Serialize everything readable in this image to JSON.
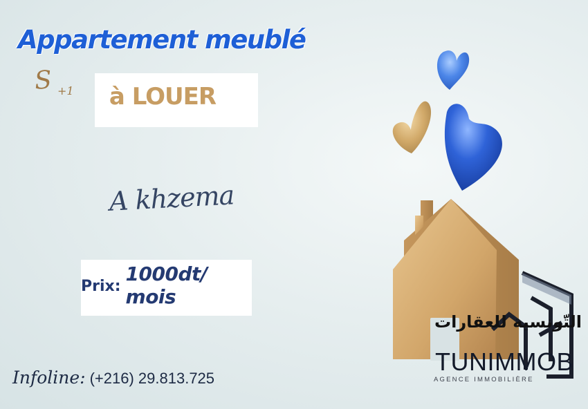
{
  "listing": {
    "title": "Appartement meublé",
    "type_main": "S",
    "type_sup": "+1",
    "status": "à LOUER",
    "location": "A khzema",
    "price_label": "Prix:",
    "price_value": "1000dt/ mois"
  },
  "contact": {
    "label": "Infoline:",
    "phone": "(+216) 29.813.725"
  },
  "brand": {
    "arabic_name": "التّونسية للعقارات",
    "name": "TUNIMMOB",
    "tagline": "AGENCE IMMOBILIÈRE"
  },
  "colors": {
    "title_blue": "#1e5fd6",
    "gold": "#c79d63",
    "navy": "#243a72",
    "heart_blue": "#2f63d8",
    "wood": "#d9b27c"
  },
  "illustration": {
    "elements": [
      "heart-icon",
      "heart-icon",
      "heart-icon",
      "house-icon"
    ]
  }
}
